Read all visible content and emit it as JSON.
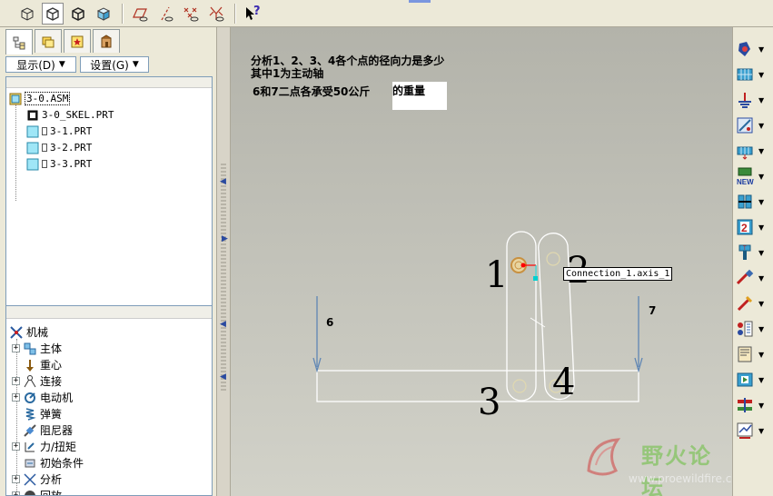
{
  "toolbar": {
    "buttons": [
      "view-wireframe",
      "view-hidden",
      "view-no-hidden",
      "view-shaded",
      "datum-planes",
      "datum-axes",
      "datum-points",
      "datum-csys",
      "whats-this"
    ],
    "help_label": "?"
  },
  "left_panel": {
    "tabs": [
      "model-tree",
      "folder-browser",
      "favorites",
      "connections"
    ],
    "display_button": "显示(D)",
    "settings_button": "设置(G)",
    "model_tree": [
      {
        "label": "3-0.ASM",
        "type": "assembly"
      },
      {
        "label": "3-0_SKEL.PRT",
        "type": "skeleton"
      },
      {
        "label": "3-1.PRT",
        "type": "part"
      },
      {
        "label": "3-2.PRT",
        "type": "part"
      },
      {
        "label": "3-3.PRT",
        "type": "part"
      }
    ],
    "mechanism_tree": [
      {
        "label": "机械",
        "expand": false
      },
      {
        "label": "主体",
        "expand": true
      },
      {
        "label": "重心",
        "expand": false
      },
      {
        "label": "连接",
        "expand": true
      },
      {
        "label": "电动机",
        "expand": true
      },
      {
        "label": "弹簧",
        "expand": false
      },
      {
        "label": "阻尼器",
        "expand": false
      },
      {
        "label": "力/扭矩",
        "expand": true
      },
      {
        "label": "初始条件",
        "expand": false
      },
      {
        "label": "分析",
        "expand": true
      },
      {
        "label": "回放",
        "expand": true
      }
    ]
  },
  "graphics": {
    "notes": [
      "分析1、2、3、4各个点的径向力是多少",
      "其中1为主动轴",
      "6和7二点各承受50公斤",
      "的重量"
    ],
    "point_labels": [
      "1",
      "2",
      "3",
      "4"
    ],
    "force_labels": [
      "6",
      "7"
    ],
    "tooltip": "Connection_1.axis_1",
    "colors": {
      "link": "#ffffff",
      "force": "#5f86b4",
      "active_axis": "#d4b070",
      "marker": "#ff0000",
      "cursor_point": "#00d0d0"
    }
  },
  "right_toolbar": {
    "icons": [
      "gear-icon",
      "grid-icon",
      "ground-icon",
      "drag-icon",
      "connect-icon",
      "new-icon",
      "spring-icon",
      "servo-motor-icon",
      "damper-icon",
      "force-icon",
      "initial-condition-icon",
      "mass-icon",
      "analysis-icon",
      "playback-icon",
      "measure-icon",
      "results-icon"
    ]
  },
  "watermark": {
    "site_name": "野火论坛",
    "url": "www.proewildfire.cn"
  }
}
